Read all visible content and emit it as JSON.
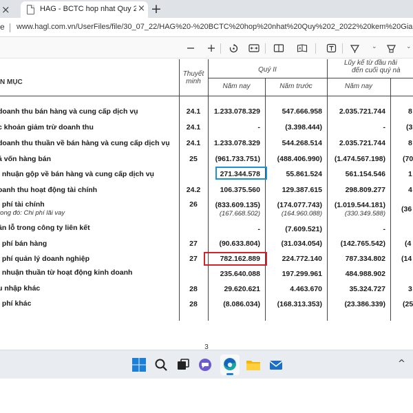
{
  "browser": {
    "tab_title": "HAG - BCTC hop nhat Quy 2_202",
    "prev_tab_close": "×",
    "tab_close": "×",
    "new_tab": "+",
    "address_left": "e",
    "url": "www.hagl.com.vn/UserFiles/file/30_07_22/HAG%20-%20BCTC%20hop%20nhat%20Quy%202_2022%20kem%20Giai%20trin"
  },
  "toolbar": {
    "icons": [
      "minus-icon",
      "plus-icon",
      "rotate-icon",
      "fit-width-icon",
      "two-page-icon",
      "read-aloud-icon",
      "draw-icon",
      "highlight-icon"
    ]
  },
  "document": {
    "header": {
      "item": "N MỤC",
      "note": "Thuyết minh",
      "q2": "Quý II",
      "q2_this_year": "Năm nay",
      "q2_last_year": "Năm trước",
      "ytd_header_1": "Lũy kế từ đầu năi",
      "ytd_header_2": "đến cuối quý nà",
      "ytd_this_year": "Năm nay"
    },
    "rows": [
      {
        "label": "doanh thu bán hàng và cung cấp dịch vụ",
        "note": "24.1",
        "q2_this": "1.233.078.329",
        "q2_last": "547.666.958",
        "ytd_this": "2.035.721.744",
        "ytd_cut": "8"
      },
      {
        "label": "c khoản giảm trừ doanh thu",
        "note": "24.1",
        "q2_this": "-",
        "q2_last": "(3.398.444)",
        "ytd_this": "-",
        "ytd_cut": "(3"
      },
      {
        "label": "doanh thu thuần về bán hàng và cung cấp dịch vụ",
        "note": "24.1",
        "q2_this": "1.233.078.329",
        "q2_last": "544.268.514",
        "ytd_this": "2.035.721.744",
        "ytd_cut": "8"
      },
      {
        "label": "á vốn hàng bán",
        "note": "25",
        "q2_this": "(961.733.751)",
        "q2_last": "(488.406.990)",
        "ytd_this": "(1.474.567.198)",
        "ytd_cut": "(70"
      },
      {
        "label": "i nhuận gộp về bán hàng và cung cấp dịch vụ",
        "note": "",
        "q2_this": "271.344.578",
        "q2_last": "55.861.524",
        "ytd_this": "561.154.546",
        "ytd_cut": "1"
      },
      {
        "label": "oanh thu hoạt động tài chính",
        "note": "24.2",
        "q2_this": "106.375.560",
        "q2_last": "129.387.615",
        "ytd_this": "298.809.277",
        "ytd_cut": "4"
      },
      {
        "label": "i phí tài chính",
        "sub": "rong đó: Chi phí lãi vay",
        "note": "26",
        "q2_this": "(833.609.135)",
        "q2_this_sub": "(167.668.502)",
        "q2_last": "(174.077.743)",
        "q2_last_sub": "(164.960.088)",
        "ytd_this": "(1.019.544.181)",
        "ytd_this_sub": "(330.349.588)",
        "ytd_cut": "(36"
      },
      {
        "label": "ần lỗ trong công ty liên kết",
        "note": "",
        "q2_this": "-",
        "q2_last": "(7.609.521)",
        "ytd_this": "-",
        "ytd_cut": ""
      },
      {
        "label": "i phí bán hàng",
        "note": "27",
        "q2_this": "(90.633.804)",
        "q2_last": "(31.034.054)",
        "ytd_this": "(142.765.542)",
        "ytd_cut": "(4"
      },
      {
        "label": "i phí quản lý doanh nghiệp",
        "note": "27",
        "q2_this": "782.162.889",
        "q2_last": "224.772.140",
        "ytd_this": "787.334.802",
        "ytd_cut": "(14"
      },
      {
        "label": "i nhuận thuần từ hoạt động kinh doanh",
        "note": "",
        "q2_this": "235.640.088",
        "q2_last": "197.299.961",
        "ytd_this": "484.988.902",
        "ytd_cut": ""
      },
      {
        "label": "u nhập khác",
        "note": "28",
        "q2_this": "29.620.621",
        "q2_last": "4.463.670",
        "ytd_this": "35.324.727",
        "ytd_cut": "3"
      },
      {
        "label": "i phí khác",
        "note": "28",
        "q2_this": "(8.086.034)",
        "q2_last": "(168.313.353)",
        "ytd_this": "(23.386.339)",
        "ytd_cut": "(25"
      }
    ],
    "page_number": "3"
  },
  "highlights": {
    "blue": "#1e90d6",
    "red": "#d6202b"
  },
  "taskbar": {
    "icons": [
      "windows-start-icon",
      "search-icon",
      "task-view-icon",
      "teams-chat-icon",
      "edge-browser-icon",
      "file-explorer-icon",
      "mail-icon"
    ],
    "tray_up": "^"
  }
}
